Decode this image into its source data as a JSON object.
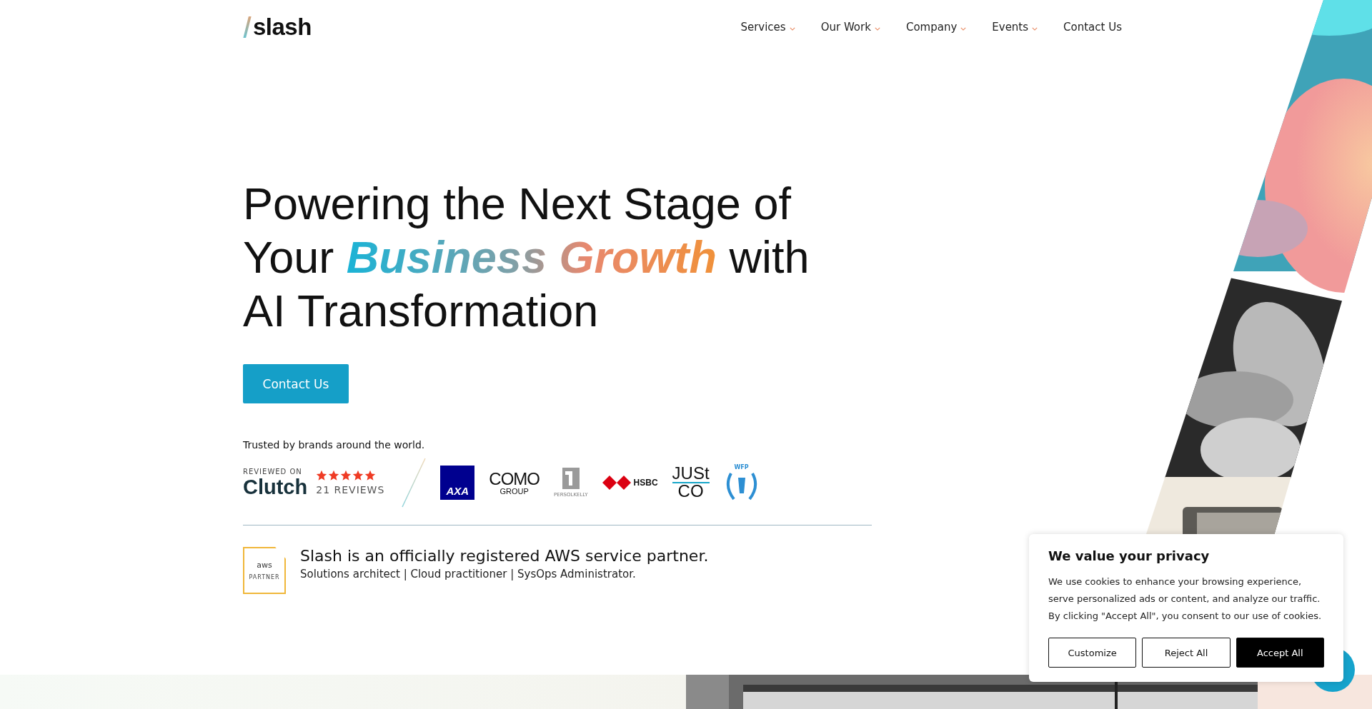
{
  "header": {
    "logo": "slash",
    "nav": [
      {
        "label": "Services",
        "has_menu": true
      },
      {
        "label": "Our Work",
        "has_menu": true
      },
      {
        "label": "Company",
        "has_menu": true
      },
      {
        "label": "Events",
        "has_menu": true
      },
      {
        "label": "Contact Us",
        "has_menu": false
      }
    ]
  },
  "hero": {
    "headline": [
      [
        {
          "text": "Powering the Next Stage of",
          "highlight": false
        }
      ],
      [
        {
          "text": "Your ",
          "highlight": false
        },
        {
          "text": "Business Growth",
          "highlight": true
        },
        {
          "text": " with",
          "highlight": false
        }
      ],
      [
        {
          "text": "AI Transformation",
          "highlight": false
        }
      ]
    ],
    "cta": "Contact Us",
    "trusted": "Trusted by brands around the world.",
    "review": {
      "reviewed_on": "REVIEWED ON",
      "site": "Clutch",
      "stars": 5,
      "count": "21 REVIEWS"
    },
    "brands": [
      {
        "kind": "axa",
        "text": "AXA"
      },
      {
        "kind": "como",
        "text": "COMO",
        "sub": "GROUP"
      },
      {
        "kind": "persol",
        "text": "PERSOLKELLY"
      },
      {
        "kind": "hsbc",
        "text": "HSBC"
      },
      {
        "kind": "justco",
        "text": "JUSt",
        "sub": "CO"
      },
      {
        "kind": "wfp",
        "text": "WFP"
      }
    ],
    "partner": {
      "badge_top": "aws",
      "badge_bottom": "PARTNER",
      "title": "Slash is an officially registered AWS service partner.",
      "subtitle": "Solutions architect | Cloud practitioner | SysOps Administrator."
    }
  },
  "cookie_banner": {
    "title": "We value your privacy",
    "text": "We use cookies to enhance your browsing experience, serve personalized ads or content, and analyze our traffic. By clicking \"Accept All\", you consent to our use of cookies.",
    "buttons": [
      {
        "label": "Customize",
        "kind": "outline"
      },
      {
        "label": "Reject All",
        "kind": "outline"
      },
      {
        "label": "Accept All",
        "kind": "solid"
      }
    ]
  }
}
